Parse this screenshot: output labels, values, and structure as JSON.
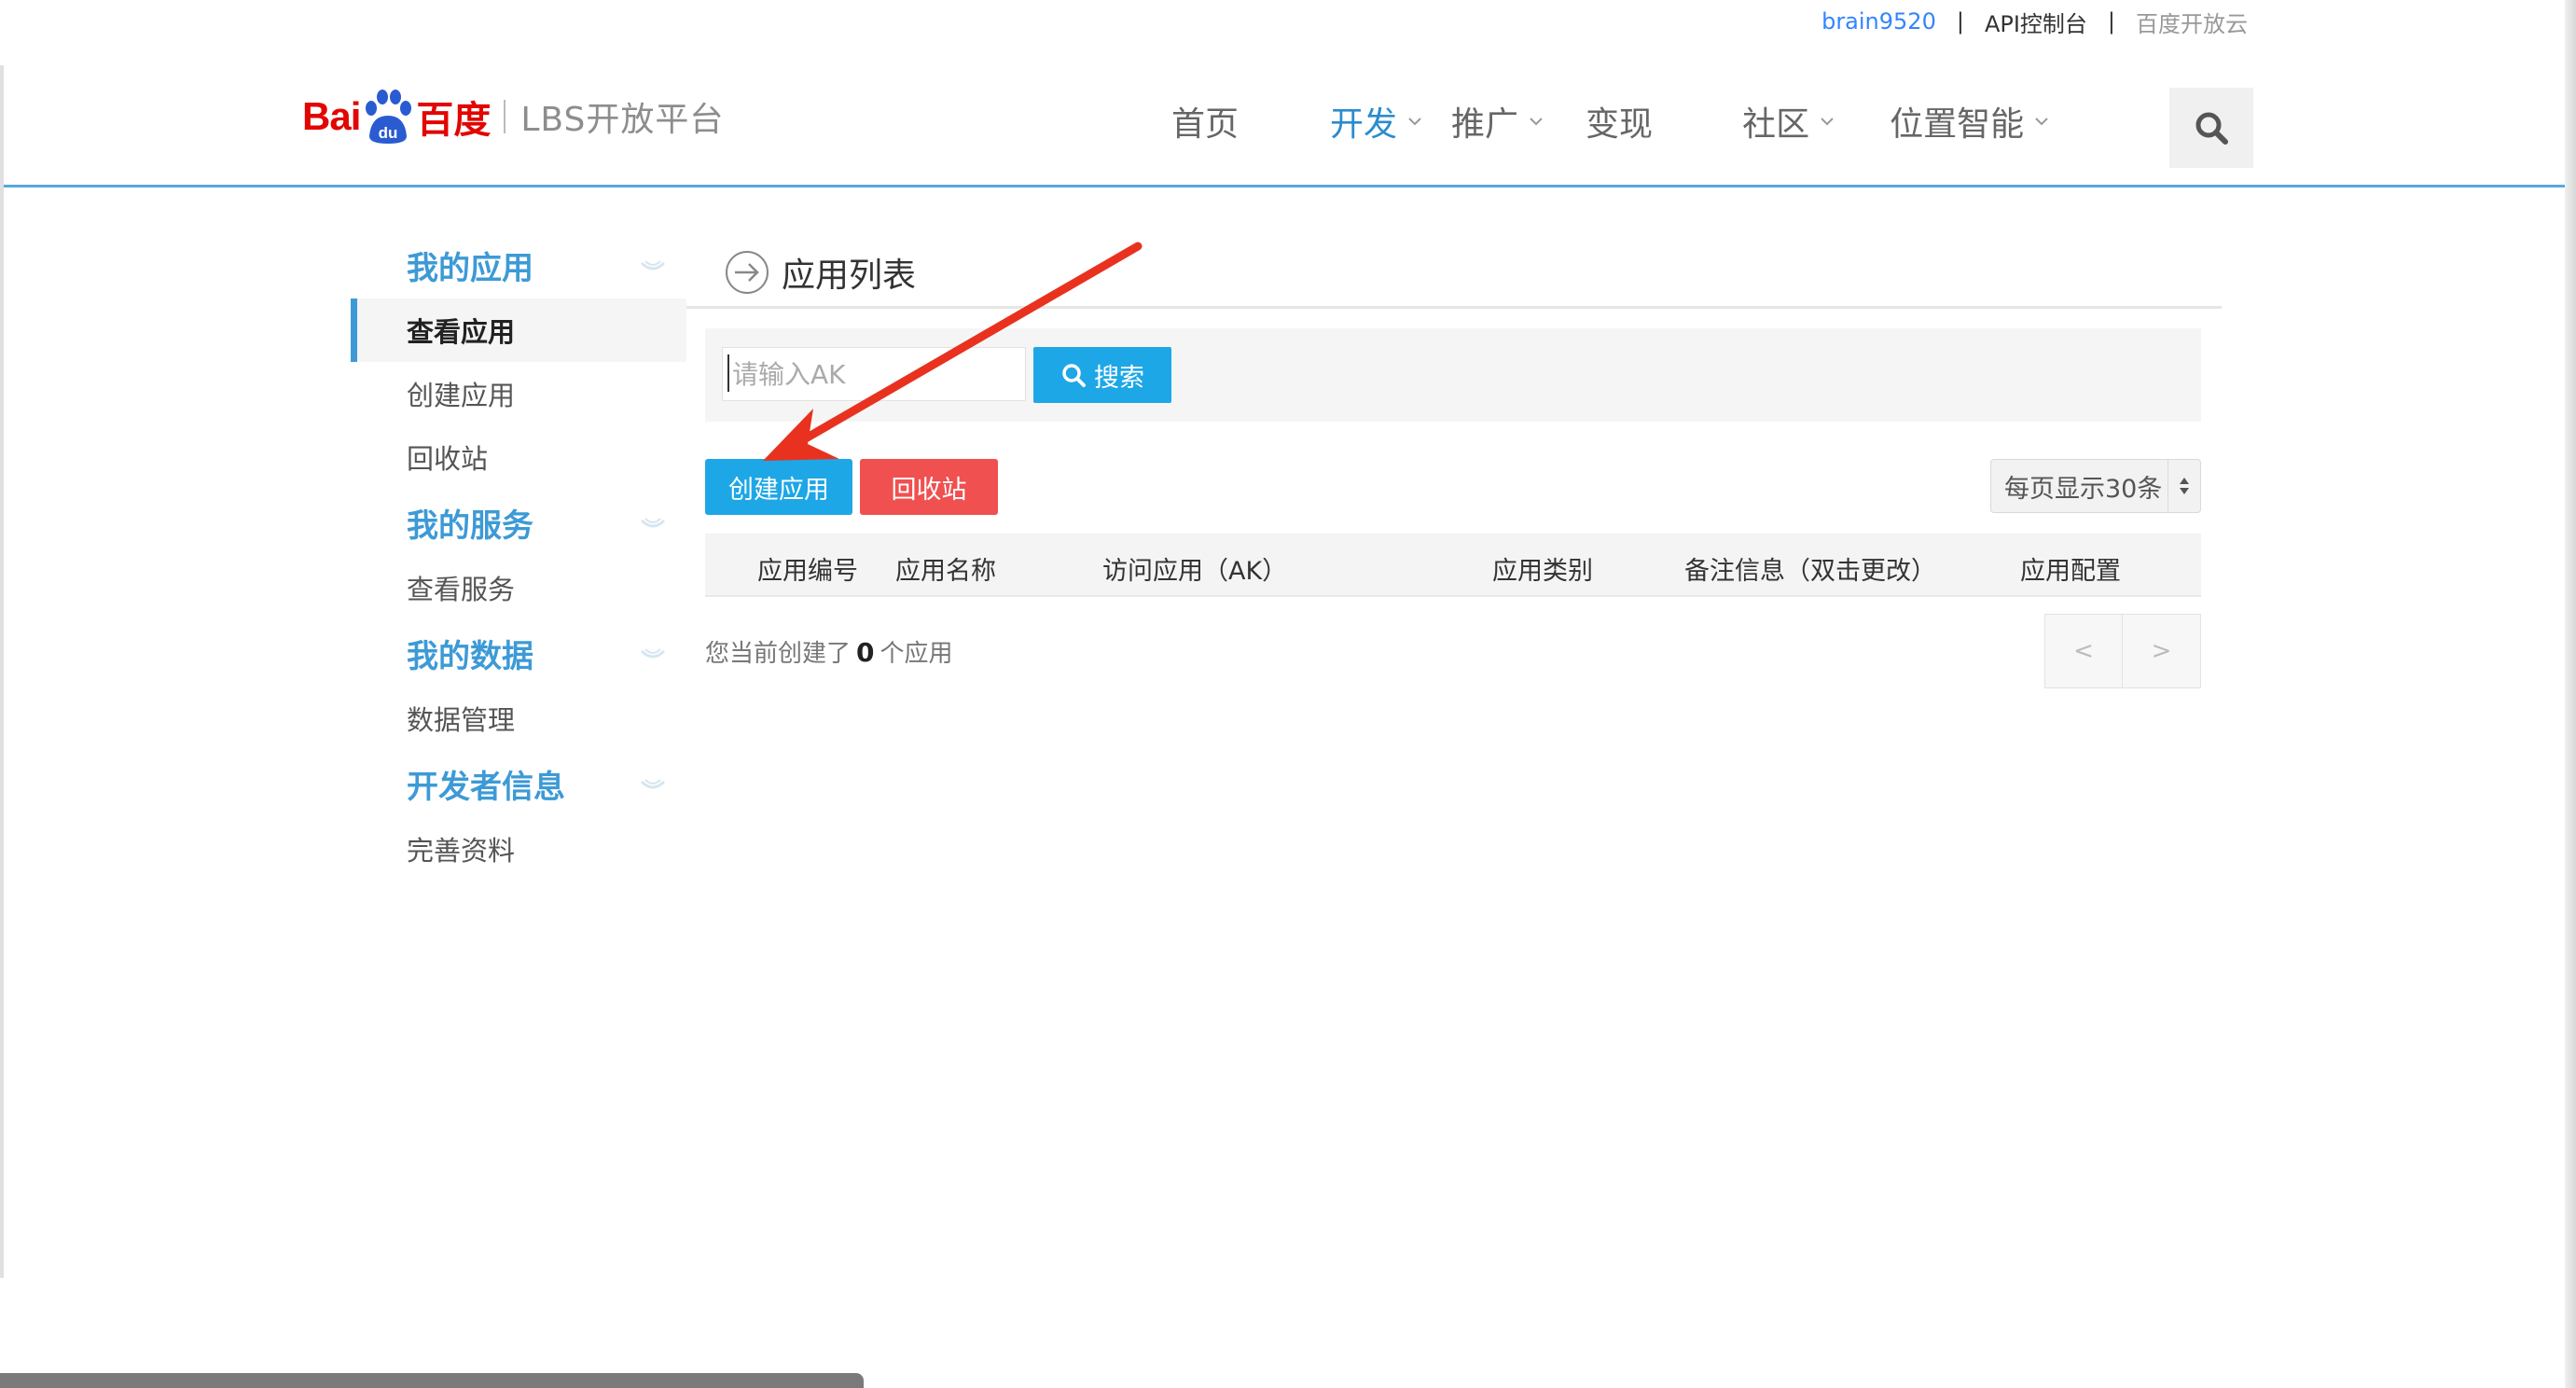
{
  "topbar": {
    "user": "brain9520",
    "sep1": "|",
    "api_console": "API控制台",
    "sep2": "|",
    "baidu_cloud": "百度开放云"
  },
  "header": {
    "logo": {
      "bai": "Bai",
      "du": "du",
      "baidu_cn": "百度",
      "platform": "LBS开放平台"
    },
    "nav": [
      {
        "label": "首页",
        "has_dropdown": false,
        "active": false
      },
      {
        "label": "开发",
        "has_dropdown": true,
        "active": true
      },
      {
        "label": "推广",
        "has_dropdown": true,
        "active": false
      },
      {
        "label": "变现",
        "has_dropdown": false,
        "active": false
      },
      {
        "label": "社区",
        "has_dropdown": true,
        "active": false
      },
      {
        "label": "位置智能",
        "has_dropdown": true,
        "active": false
      }
    ],
    "search_icon": "search-icon"
  },
  "sidebar": {
    "groups": [
      {
        "title": "我的应用",
        "items": [
          "查看应用",
          "创建应用",
          "回收站"
        ]
      },
      {
        "title": "我的服务",
        "items": [
          "查看服务"
        ]
      },
      {
        "title": "我的数据",
        "items": [
          "数据管理"
        ]
      },
      {
        "title": "开发者信息",
        "items": [
          "完善资料"
        ]
      }
    ],
    "active_item": "查看应用"
  },
  "main": {
    "title": "应用列表",
    "search": {
      "placeholder": "请输入AK",
      "button": "搜索"
    },
    "buttons": {
      "create": "创建应用",
      "recycle": "回收站"
    },
    "page_size": "每页显示30条",
    "table": {
      "columns": [
        "应用编号",
        "应用名称",
        "访问应用（AK）",
        "应用类别",
        "备注信息（双击更改）",
        "应用配置"
      ]
    },
    "count": {
      "prefix": "您当前创建了",
      "value": "0",
      "suffix": "个应用"
    },
    "pager": {
      "prev": "<",
      "next": ">"
    }
  },
  "colors": {
    "accent_blue": "#1ea7e6",
    "danger_red": "#f05050",
    "sidebar_blue": "#3d9ad6",
    "annotation_arrow": "#e8321f"
  }
}
